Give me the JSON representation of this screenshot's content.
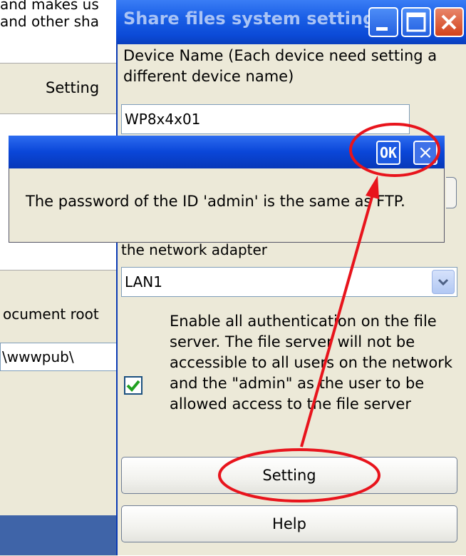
{
  "background_window": {
    "text_line1": "and makes us",
    "text_line2": "and other sha",
    "setting_button": "Setting",
    "doc_root_label": "ocument root",
    "doc_root_value": "\\wwwpub\\"
  },
  "dialog": {
    "title": "Share files system setting",
    "device_name_label": "Device Name (Each device need setting a different device name)",
    "device_name_value": "WP8x4x01",
    "adapter_label": "the network adapter",
    "adapter_value": "LAN1",
    "auth_checkbox_checked": true,
    "auth_label": "Enable all authentication on the file server. The file server will not be accessible to all users on the network and the \"admin\" as the user to be allowed access to the file server",
    "setting_button": "Setting",
    "help_button": "Help"
  },
  "message_box": {
    "text": "The password of the ID 'admin' is the same as FTP.",
    "ok_button": "OK",
    "close_glyph": "×"
  },
  "colors": {
    "annotation_red": "#e8141c",
    "titlebar_blue": "#0a46d8",
    "check_green": "#21a121"
  }
}
